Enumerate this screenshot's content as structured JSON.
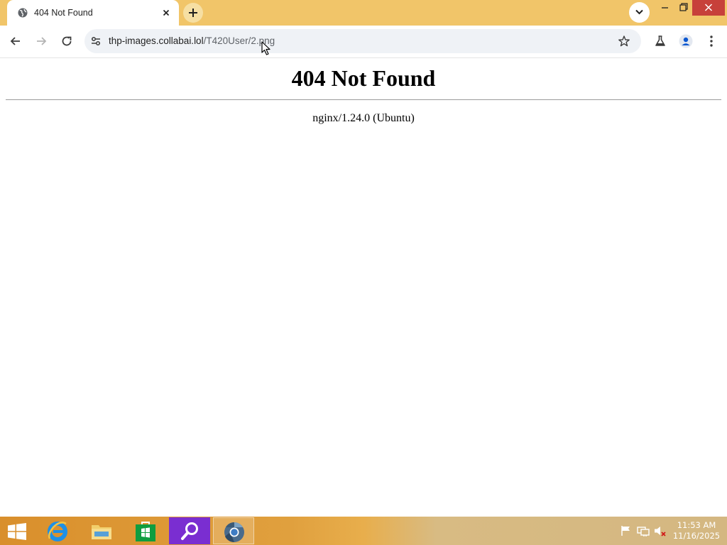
{
  "browser": {
    "tab": {
      "title": "404 Not Found",
      "favicon": "globe-icon"
    },
    "address_bar": {
      "url_host": "thp-images.collabai.lol",
      "url_path": "/T420User/2.png"
    },
    "accent_color": "#f1c569"
  },
  "page": {
    "heading": "404 Not Found",
    "server": "nginx/1.24.0 (Ubuntu)"
  },
  "taskbar": {
    "apps": [
      {
        "name": "Internet Explorer",
        "icon": "internet-explorer-icon"
      },
      {
        "name": "File Explorer",
        "icon": "folder-icon"
      },
      {
        "name": "Store",
        "icon": "store-icon"
      },
      {
        "name": "Search",
        "icon": "magnifier-icon"
      },
      {
        "name": "Chrome",
        "icon": "chrome-icon"
      }
    ],
    "clock": {
      "time": "11:53 AM",
      "date": "11/16/2025"
    }
  }
}
